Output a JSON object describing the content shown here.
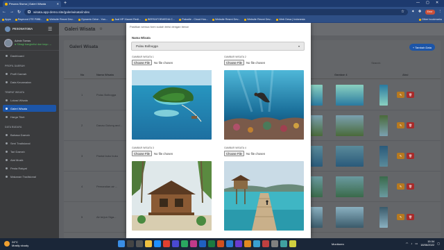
{
  "browser": {
    "tab_title": "Pesona Sisma | Galeri Wisata",
    "url": "wisata.app-demo.site/galeriwisata/index",
    "profile_label": "Error",
    "bookmarks": [
      "Apps",
      "Rayeond 2TE Fliff8...",
      "Website Resmi Dev...",
      "Dynamic Drive - Yan...",
      "Jual HP Xiaomi Redi...",
      "BERSATOEMEDIA C...",
      "Pakadie - Cloud Hos...",
      "Website Resmi Dev...",
      "Website Resmi Dev...",
      "Web Desa | Indonesia"
    ],
    "other_bookmarks": "Other bookmarks"
  },
  "sidebar": {
    "brand": "PESONATOBA",
    "user_name": "Admin Toeras",
    "user_status": "● Sibagi bangkeliui dan kayu →",
    "sections": [
      {
        "title": "",
        "items": [
          {
            "label": "Dashboard",
            "active": false
          }
        ]
      },
      {
        "title": "PROFIL DAERAH",
        "items": [
          {
            "label": "Profil Daerah",
            "active": false
          },
          {
            "label": "Data Kecamatan",
            "active": false
          }
        ]
      },
      {
        "title": "TEMPAT WISATA",
        "items": [
          {
            "label": "Lokasi Wisata",
            "active": false
          },
          {
            "label": "Galeri Wisata",
            "active": true
          },
          {
            "label": "Harga Tiket",
            "active": false
          }
        ]
      },
      {
        "title": "DATA BUDAYA",
        "items": [
          {
            "label": "Bahasa Daerah",
            "active": false
          },
          {
            "label": "Seni Tradisional",
            "active": false
          },
          {
            "label": "Tari Daerah",
            "active": false
          },
          {
            "label": "Alat Musik",
            "active": false
          },
          {
            "label": "Pesta Rakyat",
            "active": false
          },
          {
            "label": "Makanan Tradisional",
            "active": false
          }
        ]
      }
    ]
  },
  "page": {
    "title": "Galeri Wisata",
    "content_title": "Galeri Wisata",
    "add_button": "+ Tambah Data",
    "search_label": "Search:",
    "columns": {
      "no": "No",
      "name": "Nama Wisata",
      "gambar4": "Gambar 4",
      "aksi": "Aksi"
    },
    "rows": [
      {
        "no": "1",
        "name": "Pulau Bolbogga"
      },
      {
        "no": "2",
        "name": "Danau Gulung and..."
      },
      {
        "no": "3",
        "name": "Pantai buku buku"
      },
      {
        "no": "4",
        "name": "Pemandian air ..."
      },
      {
        "no": "5",
        "name": "Air terjun Siga..."
      }
    ]
  },
  "modal": {
    "note": "Pastikan semua form sudah terisi dengan benar",
    "select_label": "Nama Wisata",
    "select_value": "Pulau Bolbogga",
    "file_button": "Choose File",
    "file_none": "No file chosen",
    "gallery_labels": [
      "GAMBAR WISATA 1",
      "GAMBAR WISATA 2",
      "GAMBAR WISATA 3",
      "GAMBAR WISATA 4"
    ]
  },
  "taskbar": {
    "weather_temp": "24°C",
    "weather_desc": "Mostly cloudy",
    "monitor_label": "Monitoren",
    "time": "15:34",
    "date": "18/06/2022"
  },
  "colors": {
    "accent": "#1c55a8",
    "edit": "#b7791f",
    "delete": "#a82a2a"
  }
}
